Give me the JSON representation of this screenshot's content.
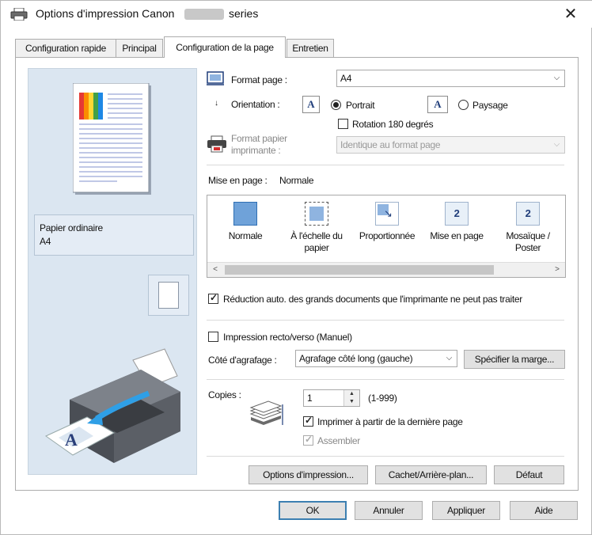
{
  "window": {
    "title_prefix": "Options d'impression Canon",
    "title_suffix": "series",
    "close_glyph": "✕"
  },
  "tabs": [
    {
      "label": "Configuration rapide",
      "active": false
    },
    {
      "label": "Principal",
      "active": false
    },
    {
      "label": "Configuration de la page",
      "active": true
    },
    {
      "label": "Entretien",
      "active": false
    }
  ],
  "preview": {
    "paper_type": "Papier ordinaire",
    "paper_size": "A4"
  },
  "page_setup": {
    "page_size_label": "Format page :",
    "page_size_value": "A4",
    "orientation_label": "Orientation :",
    "orientation_portrait_label": "Portrait",
    "orientation_landscape_label": "Paysage",
    "orientation_selected": "Portrait",
    "orientation_icon_letter": "A",
    "rotate_180_label": "Rotation 180 degrés",
    "rotate_180_checked": false,
    "printer_paper_size_label_line1": "Format papier",
    "printer_paper_size_label_line2": "imprimante :",
    "printer_paper_size_value": "Identique au format page",
    "page_layout_label": "Mise en page :",
    "page_layout_value": "Normale",
    "layout_options": [
      {
        "label_line1": "Normale",
        "label_line2": "",
        "icon": "normal-layout-icon",
        "selected": true
      },
      {
        "label_line1": "À l'échelle du",
        "label_line2": "papier",
        "icon": "fit-to-paper-icon",
        "selected": false
      },
      {
        "label_line1": "Proportionnée",
        "label_line2": "",
        "icon": "scaled-icon",
        "selected": false
      },
      {
        "label_line1": "Mise en page",
        "label_line2": "",
        "icon": "page-layout-icon",
        "selected": false,
        "badge": "2"
      },
      {
        "label_line1": "Mosaïque /",
        "label_line2": "Poster",
        "icon": "tiling-poster-icon",
        "selected": false,
        "badge": "2"
      }
    ],
    "auto_reduce_label": "Réduction auto. des grands documents que l'imprimante ne peut pas traiter",
    "auto_reduce_checked": true,
    "duplex_label": "Impression recto/verso (Manuel)",
    "duplex_checked": false,
    "stapling_label": "Côté d'agrafage :",
    "stapling_value": "Agrafage côté long (gauche)",
    "specify_margin_button": "Spécifier la marge...",
    "copies_label": "Copies :",
    "copies_value": "1",
    "copies_range": "(1-999)",
    "print_from_last_label": "Imprimer à partir de la dernière page",
    "print_from_last_checked": true,
    "collate_label": "Assembler",
    "collate_checked": true,
    "collate_disabled": true,
    "print_options_button": "Options d'impression...",
    "stamp_background_button": "Cachet/Arrière-plan...",
    "defaults_button": "Défaut"
  },
  "footer": {
    "ok_button": "OK",
    "cancel_button": "Annuler",
    "apply_button": "Appliquer",
    "help_button": "Aide"
  },
  "colors": {
    "preview_bg": "#dbe6f1",
    "default_button_border": "#3c7fb1",
    "accent_blue": "#2f6fb3"
  }
}
